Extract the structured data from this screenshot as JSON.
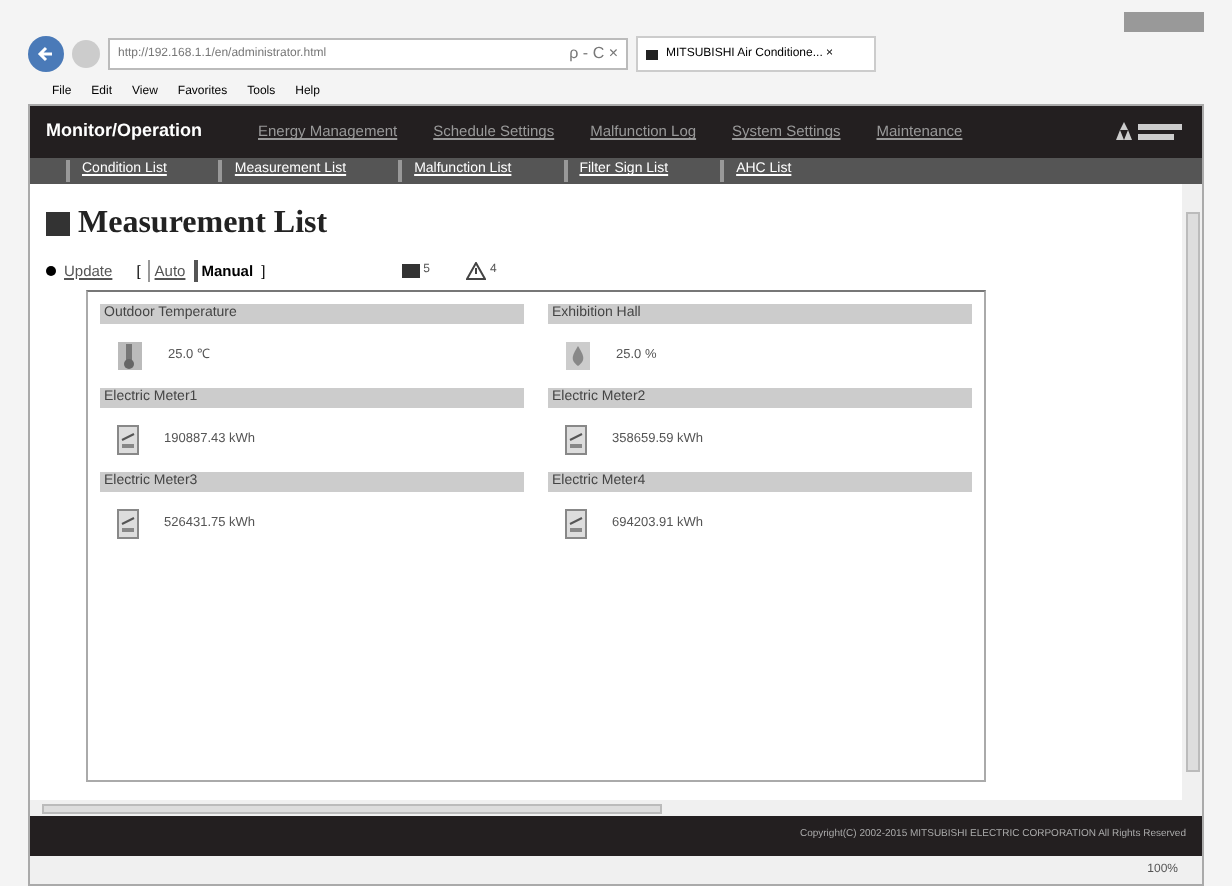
{
  "browser": {
    "address": "http://192.168.1.1/en/administrator.html",
    "address_controls": "ρ - C ×",
    "tab_title": "MITSUBISHI Air Conditione... ×",
    "menu": [
      "File",
      "Edit",
      "View",
      "Favorites",
      "Tools",
      "Help"
    ],
    "zoom": "100%"
  },
  "nav": [
    {
      "label": "Monitor/Operation",
      "selected": true
    },
    {
      "label": "Energy Management",
      "selected": false
    },
    {
      "label": "Schedule Settings",
      "selected": false
    },
    {
      "label": "Malfunction Log",
      "selected": false
    },
    {
      "label": "System Settings",
      "selected": false
    },
    {
      "label": "Maintenance",
      "selected": false
    }
  ],
  "subnav": [
    {
      "label": "Condition List"
    },
    {
      "label": "Measurement List"
    },
    {
      "label": "Malfunction List"
    },
    {
      "label": "Filter Sign List"
    },
    {
      "label": "AHC List"
    }
  ],
  "page_title": "Measurement List",
  "update": {
    "link": "Update",
    "open": "[",
    "auto": "Auto",
    "manual": "Manual",
    "close": "]",
    "auto_selected": false,
    "manual_selected": true
  },
  "counts": [
    {
      "kind": "square",
      "value": "5"
    },
    {
      "kind": "warning",
      "value": "4"
    }
  ],
  "measurements": [
    {
      "name": "Outdoor Temperature",
      "kind": "thermometer",
      "value": "25.0 ℃"
    },
    {
      "name": "Exhibition Hall",
      "kind": "humidity",
      "value": "25.0 %"
    },
    {
      "name": "Electric Meter1",
      "kind": "meter",
      "value": "190887.43 kWh"
    },
    {
      "name": "Electric Meter2",
      "kind": "meter",
      "value": "358659.59 kWh"
    },
    {
      "name": "Electric Meter3",
      "kind": "meter",
      "value": "526431.75 kWh"
    },
    {
      "name": "Electric Meter4",
      "kind": "meter",
      "value": "694203.91 kWh"
    }
  ],
  "footer": "Copyright(C) 2002-2015 MITSUBISHI ELECTRIC CORPORATION All Rights Reserved"
}
